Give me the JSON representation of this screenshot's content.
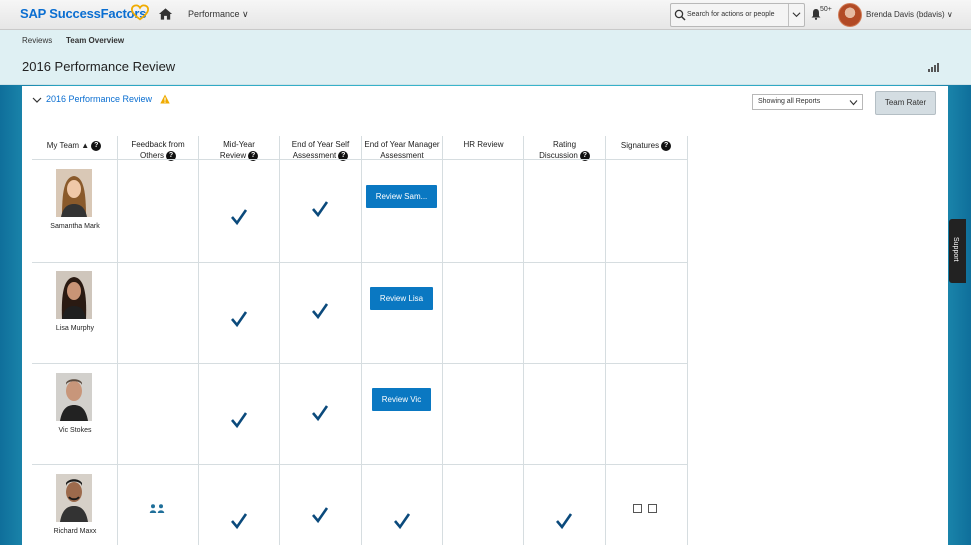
{
  "header": {
    "logo_text": "SAP SuccessFactors",
    "module": "Performance ∨",
    "search_placeholder": "Search for actions or people",
    "notifications": "50+",
    "user": "Brenda Davis (bdavis) ∨"
  },
  "breadcrumbs": [
    "Reviews",
    "Team Overview"
  ],
  "page_title": "2016 Performance Review",
  "section": {
    "title": "2016 Performance Review",
    "filter_value": "Showing all Reports",
    "team_rater_label": "Team Rater"
  },
  "columns": {
    "my_team": "My Team ▲",
    "feedback": [
      "Feedback from",
      "Others"
    ],
    "mid_year": [
      "Mid-Year",
      "Review"
    ],
    "eoy_self": [
      "End of Year Self",
      "Assessment"
    ],
    "eoy_manager": [
      "End of Year Manager",
      "Assessment"
    ],
    "hr_review": "HR Review",
    "rating": [
      "Rating",
      "Discussion"
    ],
    "signatures": "Signatures"
  },
  "help_glyph": "?",
  "rows": [
    {
      "name": "Samantha Mark",
      "review_button": "Review Sam...",
      "feedback_icon": false,
      "mid_year_done": true,
      "self_done": true,
      "manager_done": false,
      "rating_done": false,
      "signatures": false
    },
    {
      "name": "Lisa Murphy",
      "review_button": "Review Lisa",
      "feedback_icon": false,
      "mid_year_done": true,
      "self_done": true,
      "manager_done": false,
      "rating_done": false,
      "signatures": false
    },
    {
      "name": "Vic Stokes",
      "review_button": "Review Vic",
      "feedback_icon": false,
      "mid_year_done": true,
      "self_done": true,
      "manager_done": false,
      "rating_done": false,
      "signatures": false
    },
    {
      "name": "Richard Maxx",
      "review_button": "",
      "feedback_icon": true,
      "mid_year_done": true,
      "self_done": true,
      "manager_done": true,
      "rating_done": true,
      "signatures": true
    }
  ],
  "support_label": "Support",
  "colors": {
    "brand_blue": "#0a6ed1",
    "button_blue": "#0a78c2",
    "check_navy": "#0b4a7c",
    "accent_orange": "#f0ab00"
  }
}
